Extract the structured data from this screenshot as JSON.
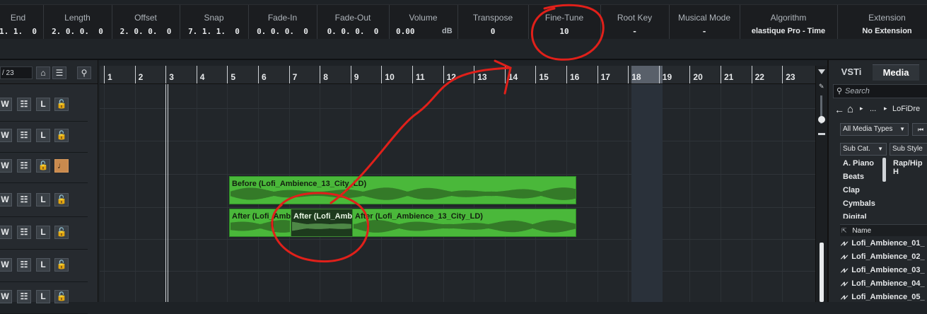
{
  "info_line": {
    "columns": [
      {
        "label": "End",
        "value": "1. 1.  0"
      },
      {
        "label": "Length",
        "value": "2. 0. 0.  0"
      },
      {
        "label": "Offset",
        "value": "2. 0. 0.  0"
      },
      {
        "label": "Snap",
        "value": "7. 1. 1.  0"
      },
      {
        "label": "Fade-In",
        "value": "0. 0. 0.  0"
      },
      {
        "label": "Fade-Out",
        "value": "0. 0. 0.  0"
      },
      {
        "label": "Volume",
        "value": "0.00",
        "unit": "dB"
      },
      {
        "label": "Transpose",
        "value": "0"
      },
      {
        "label": "Fine-Tune",
        "value": "10"
      },
      {
        "label": "Root Key",
        "value": "-"
      },
      {
        "label": "Musical Mode",
        "value": "-"
      },
      {
        "label": "Algorithm",
        "value": "elastique Pro - Time"
      },
      {
        "label": "Extension",
        "value": "No Extension"
      }
    ]
  },
  "track_header": {
    "zoom_value": "/ 23",
    "rows": [
      {
        "buttons": [
          "W",
          "☷",
          "L",
          "🔓"
        ],
        "extra": ""
      },
      {
        "buttons": [
          "W",
          "☷",
          "L",
          "🔓"
        ],
        "extra": ""
      },
      {
        "buttons": [
          "W",
          "☷",
          "🔓",
          "♩"
        ],
        "extra": "on"
      },
      {
        "buttons": [
          "W",
          "☷",
          "L",
          "🔓"
        ],
        "extra": ""
      },
      {
        "buttons": [
          "W",
          "☷",
          "L",
          "🔓"
        ],
        "extra": ""
      },
      {
        "buttons": [
          "W",
          "☷",
          "L",
          "🔓"
        ],
        "extra": ""
      },
      {
        "buttons": [
          "W",
          "☷",
          "L",
          "🔓"
        ],
        "extra": ""
      }
    ]
  },
  "ruler": {
    "bars": [
      "1",
      "2",
      "3",
      "4",
      "5",
      "6",
      "7",
      "8",
      "9",
      "10",
      "11",
      "12",
      "13",
      "14",
      "15",
      "16",
      "17",
      "18",
      "19",
      "20",
      "21",
      "22",
      "23"
    ],
    "highlighted_bar": "18"
  },
  "events": [
    {
      "title": "Before (Lofi_Ambience_13_City_LD)",
      "selected": false
    },
    {
      "title": "After (Lofi_Amb",
      "selected": false
    },
    {
      "title": "After (Lofi_Amb",
      "selected": true
    },
    {
      "title": "After (Lofi_Ambience_13_City_LD)",
      "selected": false
    }
  ],
  "right_zone": {
    "tabs": [
      "VSTi",
      "Media"
    ],
    "active_tab": "Media",
    "search_placeholder": "Search",
    "breadcrumb": [
      "...",
      "LoFiDre"
    ],
    "media_type_filter": "All Media Types",
    "sub_cat_label": "Sub Cat.",
    "sub_style_label": "Sub Style",
    "categories": [
      "A. Piano",
      "Beats",
      "Clap",
      "Cymbals",
      "Digital"
    ],
    "styles": [
      "Rap/Hip H"
    ],
    "name_header": "Name",
    "files": [
      "Lofi_Ambience_01_",
      "Lofi_Ambience_02_",
      "Lofi_Ambience_03_",
      "Lofi_Ambience_04_",
      "Lofi_Ambience_05_"
    ]
  },
  "colors": {
    "event_green": "#4ab83a",
    "annotation_red": "#e0201a",
    "background": "#1e2226"
  }
}
